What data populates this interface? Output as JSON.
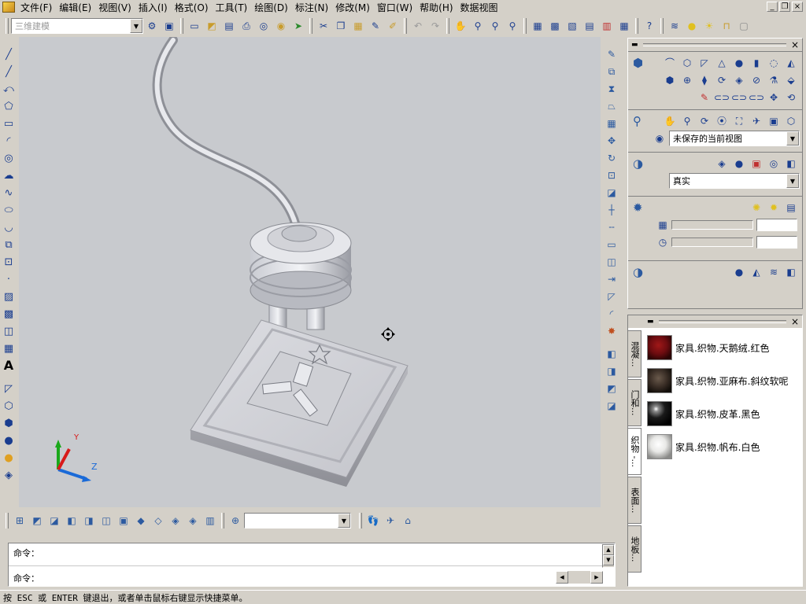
{
  "menu": {
    "items": [
      "文件(F)",
      "编辑(E)",
      "视图(V)",
      "插入(I)",
      "格式(O)",
      "工具(T)",
      "绘图(D)",
      "标注(N)",
      "修改(M)",
      "窗口(W)",
      "帮助(H)",
      "数据视图"
    ]
  },
  "window_controls": {
    "minimize": "_",
    "restore": "❐",
    "close": "×"
  },
  "toolbar": {
    "workspace": "三维建模",
    "icons": [
      "gear-icon",
      "paint-icon",
      "new-file-icon",
      "open-icon",
      "save-icon",
      "print-icon",
      "preview-icon",
      "publish-icon",
      "plot-icon",
      "cut-icon",
      "copy-icon",
      "paste-icon",
      "brush-icon",
      "match-icon",
      "undo-icon",
      "redo-icon",
      "pan-icon",
      "zoom-realtime-icon",
      "zoom-window-icon",
      "zoom-previous-icon",
      "properties-icon",
      "design-center-icon",
      "tool-palette-icon",
      "sheet-set-icon",
      "markup-icon",
      "calculator-icon",
      "help-icon",
      "layers-icon",
      "bulb-icon",
      "sun-icon",
      "lock-icon",
      "color-icon"
    ]
  },
  "dashboard": {
    "view_name": "未保存的当前视图",
    "visual_style": "真实"
  },
  "tool_palette": {
    "tabs": [
      "混凝...",
      "门和...",
      "织物 -...",
      "表面...",
      "地板..."
    ],
    "active_tab": 2,
    "materials": [
      {
        "name": "家具.织物.天鹅绒.红色",
        "color": "#6e0c10"
      },
      {
        "name": "家具.织物.亚麻布.斜纹软呢",
        "color": "#3a2e26"
      },
      {
        "name": "家具.织物.皮革.黑色",
        "color": "#1a1a1a"
      },
      {
        "name": "家具.织物.帆布.白色",
        "color": "#e8e8e6"
      }
    ]
  },
  "ucs": {
    "y_label": "Y",
    "z_label": "Z"
  },
  "command": {
    "line1_prompt": "命令：",
    "line2_prompt": "命令："
  },
  "status": {
    "text": "按 ESC 或 ENTER 键退出，或者单击鼠标右键显示快捷菜单。"
  },
  "colors": {
    "background": "#d4d0c8",
    "viewport": "#c8cace",
    "accent": "#2c5aa0"
  }
}
